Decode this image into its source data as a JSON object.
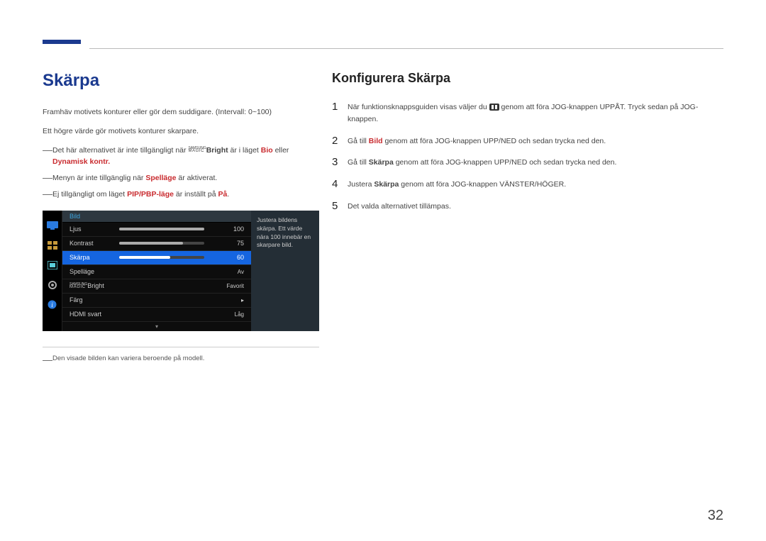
{
  "page_number": "32",
  "left": {
    "title": "Skärpa",
    "p1": "Framhäv motivets konturer eller gör dem suddigare. (Intervall: 0~100)",
    "p2": "Ett högre värde gör motivets konturer skarpare.",
    "note1_a": "Det här alternativet är inte tillgängligt när ",
    "note1_magic": "Bright",
    "note1_b": " är i läget ",
    "note1_c": "Bio",
    "note1_d": " eller ",
    "note1_e": "Dynamisk kontr.",
    "note2_a": "Menyn är inte tillgänglig när ",
    "note2_b": "Spelläge",
    "note2_c": " är aktiverat.",
    "note3_a": "Ej tillgängligt om läget ",
    "note3_b": "PIP/PBP-läge",
    "note3_c": " är inställt på ",
    "note3_d": "På",
    "note3_e": ".",
    "footnote": "Den visade bilden kan variera beroende på modell."
  },
  "osd": {
    "header": "Bild",
    "rows": [
      {
        "label": "Ljus",
        "value": "100",
        "fill": 100,
        "slider": true
      },
      {
        "label": "Kontrast",
        "value": "75",
        "fill": 75,
        "slider": true
      },
      {
        "label": "Skärpa",
        "value": "60",
        "fill": 60,
        "slider": true,
        "selected": true
      },
      {
        "label": "Spelläge",
        "value": "Av"
      },
      {
        "label_is_magic": true,
        "label": "Bright",
        "value": "Favorit"
      },
      {
        "label": "Färg",
        "value": "▸"
      },
      {
        "label": "HDMI svart",
        "value": "Låg"
      }
    ],
    "tooltip": "Justera bildens skärpa. Ett värde nära 100 innebär en skarpare bild."
  },
  "right": {
    "title": "Konfigurera Skärpa",
    "steps": {
      "s1_a": "När funktionsknappsguiden visas väljer du ",
      "s1_b": " genom att föra JOG-knappen UPPÅT. Tryck sedan på JOG-knappen.",
      "s2_a": "Gå till ",
      "s2_b": "Bild",
      "s2_c": " genom att föra JOG-knappen UPP/NED och sedan trycka ned den.",
      "s3_a": "Gå till ",
      "s3_b": "Skärpa",
      "s3_c": " genom att föra JOG-knappen UPP/NED och sedan trycka ned den.",
      "s4_a": "Justera ",
      "s4_b": "Skärpa",
      "s4_c": " genom att föra JOG-knappen VÄNSTER/HÖGER.",
      "s5": "Det valda alternativet tillämpas."
    }
  }
}
